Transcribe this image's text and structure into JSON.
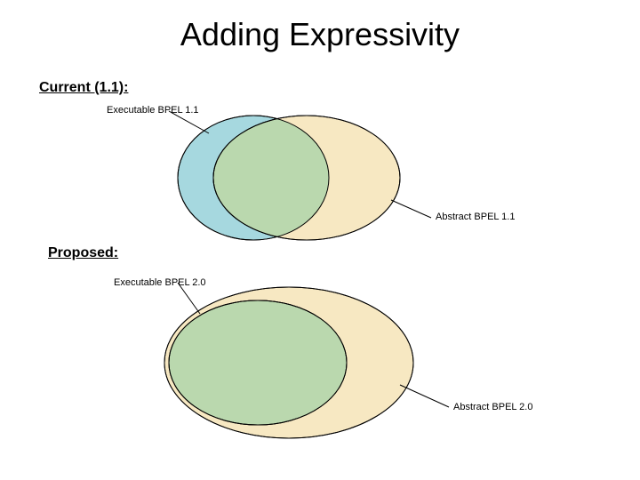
{
  "title": "Adding Expressivity",
  "sections": {
    "current": {
      "heading": "Current (1.1):",
      "labels": {
        "executable": "Executable BPEL 1.1",
        "abstract": "Abstract BPEL 1.1"
      }
    },
    "proposed": {
      "heading": "Proposed:",
      "labels": {
        "executable": "Executable BPEL 2.0",
        "abstract": "Abstract BPEL 2.0"
      }
    }
  },
  "colors": {
    "executable_fill": "#a6d8df",
    "abstract_fill": "#f7e8c2",
    "overlap_fill": "#bad8ae",
    "stroke": "#000000"
  }
}
